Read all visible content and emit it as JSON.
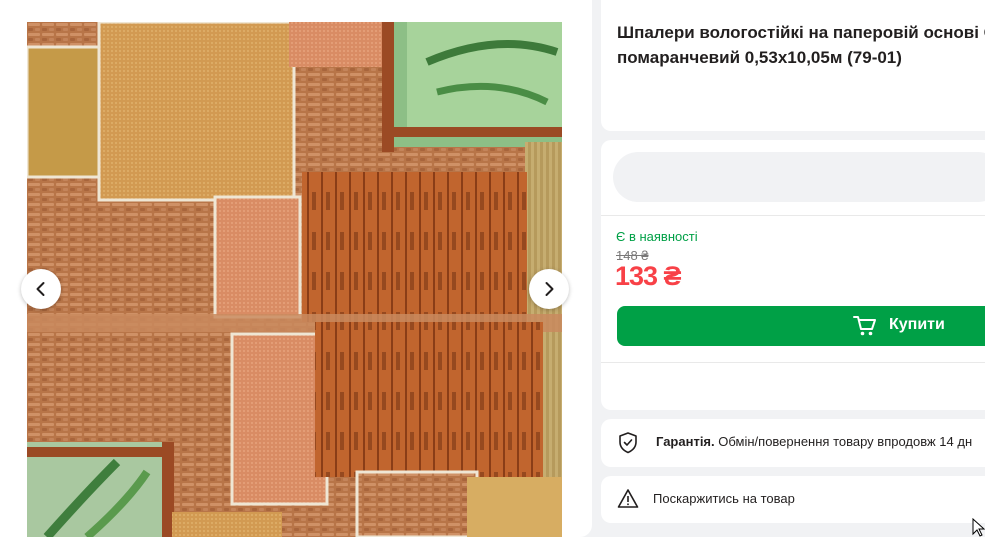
{
  "product": {
    "title_line1": "Шпалери вологостійкі на паперовій основі С",
    "title_line2": "помаранчевий 0,53x10,05м (79-01)"
  },
  "gallery": {
    "prev_icon": "chevron-left-icon",
    "next_icon": "chevron-right-icon"
  },
  "purchase": {
    "availability": "Є в наявності",
    "old_price": "148 ₴",
    "price": "133 ₴",
    "buy_label": "Купити",
    "cart_icon": "cart-icon"
  },
  "warranty": {
    "icon": "shield-check-icon",
    "label": "Гарантія.",
    "text": "Обмін/повернення товару впродовж 14 дн"
  },
  "report": {
    "icon": "warning-triangle-icon",
    "text": "Поскаржитись на товар"
  },
  "colors": {
    "accent_green": "#00a046",
    "price_red": "#f84147",
    "page_background": "#f1f2f4"
  }
}
